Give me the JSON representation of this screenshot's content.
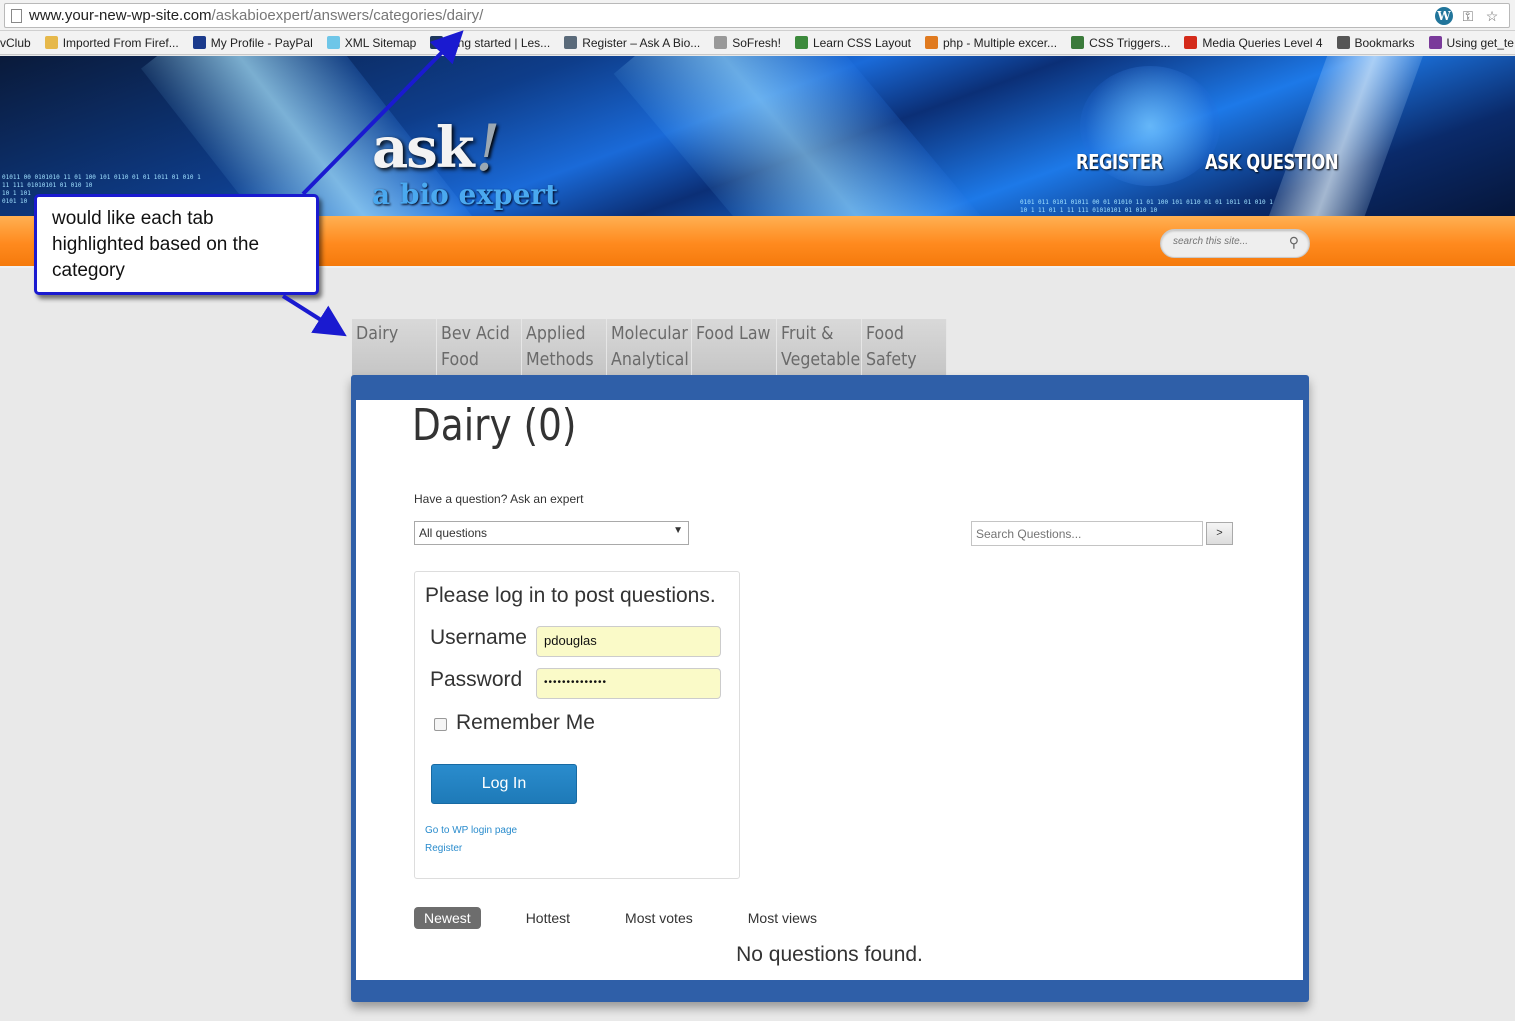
{
  "browser": {
    "url_host": "www.your-new-wp-site.com",
    "url_path": "/askabioexpert/answers/categories/dairy/",
    "bookmarks": [
      {
        "label": "vClub",
        "icon": "none",
        "color": "#ffffff"
      },
      {
        "label": "Imported From Firef...",
        "icon": "folder-icon",
        "color": "#e6b84a"
      },
      {
        "label": "My Profile - PayPal",
        "icon": "paypal-icon",
        "color": "#1b3a8c"
      },
      {
        "label": "XML Sitemap",
        "icon": "sitemap-icon",
        "color": "#6ec6e8"
      },
      {
        "label": "tting started | Les...",
        "icon": "less-icon",
        "color": "#1d365d"
      },
      {
        "label": "Register – Ask A Bio...",
        "icon": "gear-icon",
        "color": "#5a6a7a"
      },
      {
        "label": "SoFresh!",
        "icon": "page-icon",
        "color": "#999999"
      },
      {
        "label": "Learn CSS Layout",
        "icon": "globe-icon",
        "color": "#3c8a3c"
      },
      {
        "label": "php - Multiple excer...",
        "icon": "stackoverflow-icon",
        "color": "#e07a1f"
      },
      {
        "label": "CSS Triggers...",
        "icon": "dots-icon",
        "color": "#3a7a3a"
      },
      {
        "label": "Media Queries Level 4",
        "icon": "css-icon",
        "color": "#d42a1a"
      },
      {
        "label": "Bookmarks",
        "icon": "star-icon",
        "color": "#555555"
      },
      {
        "label": "Using get_te",
        "icon": "b-icon",
        "color": "#7a3a9a"
      }
    ]
  },
  "header": {
    "logo_main": "ask",
    "logo_bang": "!",
    "logo_sub": "a bio expert",
    "nav": [
      "REGISTER",
      "ASK QUESTION"
    ],
    "search_placeholder": "search this site..."
  },
  "tabs": [
    {
      "lines": [
        "Dairy"
      ]
    },
    {
      "lines": [
        "Bev Acid",
        "Food"
      ]
    },
    {
      "lines": [
        "Applied",
        "Methods"
      ]
    },
    {
      "lines": [
        "Molecular",
        "Analytical"
      ]
    },
    {
      "lines": [
        "Food Law"
      ]
    },
    {
      "lines": [
        "Fruit &",
        "Vegetable"
      ]
    },
    {
      "lines": [
        "Food",
        "Safety"
      ]
    }
  ],
  "main": {
    "title": "Dairy (0)",
    "ask_line": "Have a question? Ask an expert",
    "filter_selected": "All questions",
    "search_placeholder": "Search Questions...",
    "search_button": ">",
    "login": {
      "title": "Please log in to post questions.",
      "username_label": "Username",
      "username_value": "pdouglas",
      "password_label": "Password",
      "password_value": "••••••••••••••",
      "remember_label": "Remember Me",
      "button": "Log In",
      "wp_login_link": "Go to WP login page",
      "register_link": "Register"
    },
    "sort_tabs": [
      "Newest",
      "Hottest",
      "Most votes",
      "Most views"
    ],
    "active_sort": "Newest",
    "empty_message": "No questions found."
  },
  "annotation": {
    "text": "would like each tab highlighted based on the category",
    "color": "#1a1ad0"
  },
  "colors": {
    "orange": "#ff8a1e",
    "panel_blue": "#2f5fa8",
    "login_button": "#2a8ccd"
  }
}
